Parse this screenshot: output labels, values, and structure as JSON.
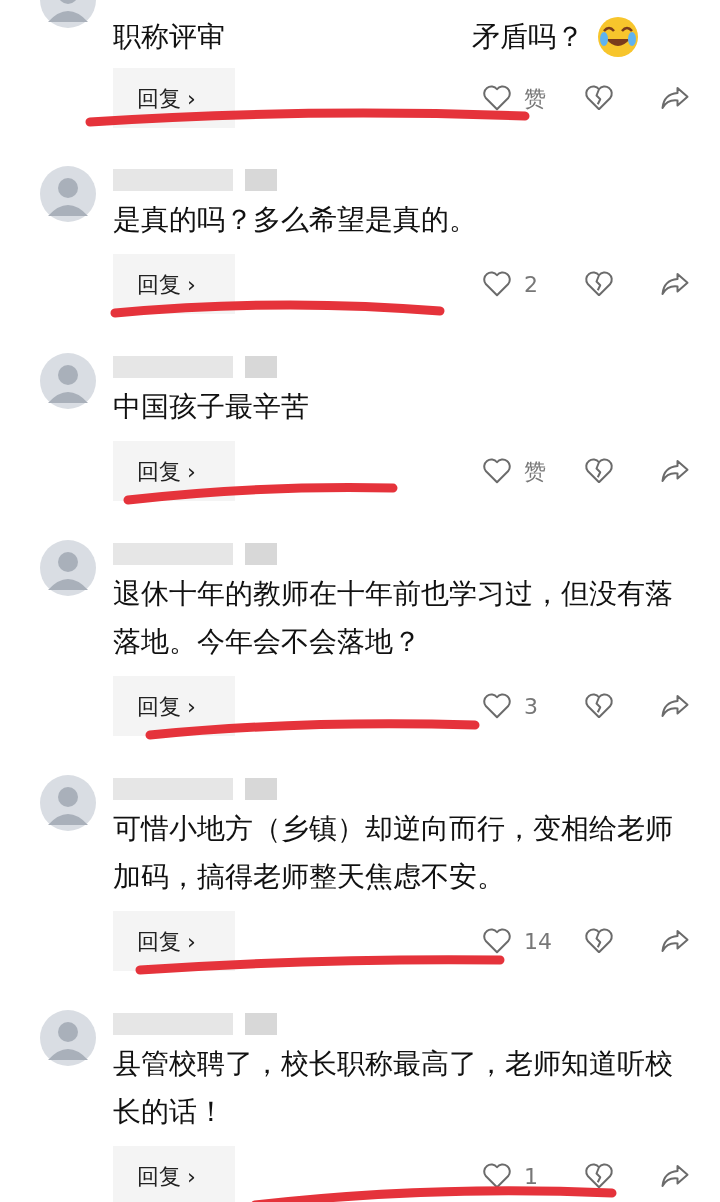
{
  "reply_arrow": "›",
  "comments": [
    {
      "avatar_cut": true,
      "text_parts": [
        "职称评审",
        "矛盾吗？"
      ],
      "emoji": true,
      "reply": "回复",
      "likes": "赞",
      "underlined": true
    },
    {
      "text_parts": [
        "是真的吗？多么希望是真的。"
      ],
      "reply": "回复",
      "likes": "2",
      "underlined": true
    },
    {
      "text_parts": [
        "中国孩子最辛苦"
      ],
      "reply": "回复",
      "likes": "赞",
      "underlined": true
    },
    {
      "text_parts": [
        "退休十年的教师在十年前也学习过，但没有落落地。今年会不会落地？"
      ],
      "reply": "回复",
      "likes": "3",
      "underlined": true
    },
    {
      "text_parts": [
        "可惜小地方（乡镇）却逆向而行，变相给老师加码，搞得老师整天焦虑不安。"
      ],
      "reply": "回复",
      "likes": "14",
      "underlined": true
    },
    {
      "text_parts": [
        "县管校聘了，校长职称最高了，老师知道听校长的话！"
      ],
      "reply": "回复",
      "likes": "1",
      "underlined": true
    }
  ]
}
